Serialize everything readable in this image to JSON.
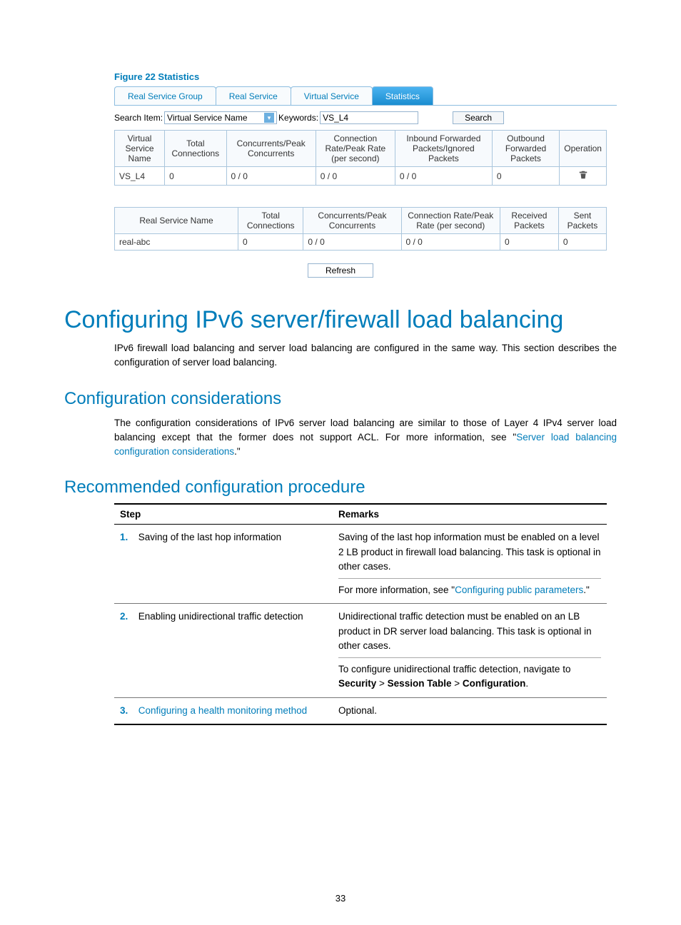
{
  "figure_label": "Figure 22 Statistics",
  "tabs": {
    "real_service_group": "Real Service Group",
    "real_service": "Real Service",
    "virtual_service": "Virtual Service",
    "statistics": "Statistics"
  },
  "search": {
    "label_item": "Search Item:",
    "select_value": "Virtual Service Name",
    "label_keywords": "Keywords:",
    "input_value": "VS_L4",
    "button": "Search"
  },
  "vtable": {
    "headers": {
      "name": "Virtual Service Name",
      "total": "Total Connections",
      "concur": "Concurrents/Peak Concurrents",
      "rate": "Connection Rate/Peak Rate (per second)",
      "inbound": "Inbound Forwarded Packets/Ignored Packets",
      "outbound": "Outbound Forwarded Packets",
      "op": "Operation"
    },
    "row": {
      "name": "VS_L4",
      "total": "0",
      "concur": "0 / 0",
      "rate": "0 / 0",
      "inbound": "0 / 0",
      "outbound": "0"
    }
  },
  "rtable": {
    "headers": {
      "name": "Real Service Name",
      "total": "Total Connections",
      "concur": "Concurrents/Peak Concurrents",
      "rate": "Connection Rate/Peak Rate (per second)",
      "recv": "Received Packets",
      "sent": "Sent Packets"
    },
    "row": {
      "name": "real-abc",
      "total": "0",
      "concur": "0 / 0",
      "rate": "0 / 0",
      "recv": "0",
      "sent": "0"
    }
  },
  "refresh": "Refresh",
  "h1": "Configuring IPv6 server/firewall load balancing",
  "intro": "IPv6 firewall load balancing and server load balancing are configured in the same way. This section describes the configuration of server load balancing.",
  "h2_cc": "Configuration considerations",
  "cc_text_1": "The configuration considerations of IPv6 server load balancing are similar to those of Layer 4 IPv4 server load balancing except that the former does not support ACL. For more information, see \"",
  "cc_link": "Server load balancing configuration considerations",
  "cc_text_2": ".\"",
  "h2_rcp": "Recommended configuration procedure",
  "proc": {
    "head_step": "Step",
    "head_remarks": "Remarks",
    "rows": [
      {
        "num": "1.",
        "step": "Saving of the last hop information",
        "remarks_a": "Saving of the last hop information must be enabled on a level 2 LB product in firewall load balancing. This task is optional in other cases.",
        "remarks_b_pre": "For more information, see \"",
        "remarks_b_link": "Configuring public parameters",
        "remarks_b_post": ".\""
      },
      {
        "num": "2.",
        "step": "Enabling unidirectional traffic detection",
        "remarks_a": "Unidirectional traffic detection must be enabled on an LB product in DR server load balancing. This task is optional in other cases.",
        "remarks_b_pre": "To configure unidirectional traffic detection, navigate to ",
        "remarks_b_bold1": "Security",
        "remarks_b_mid": " > ",
        "remarks_b_bold2": "Session Table",
        "remarks_b_mid2": " > ",
        "remarks_b_bold3": "Configuration",
        "remarks_b_post": "."
      },
      {
        "num": "3.",
        "step": "Configuring a health monitoring method",
        "remarks_a": "Optional."
      }
    ]
  },
  "page_number": "33"
}
